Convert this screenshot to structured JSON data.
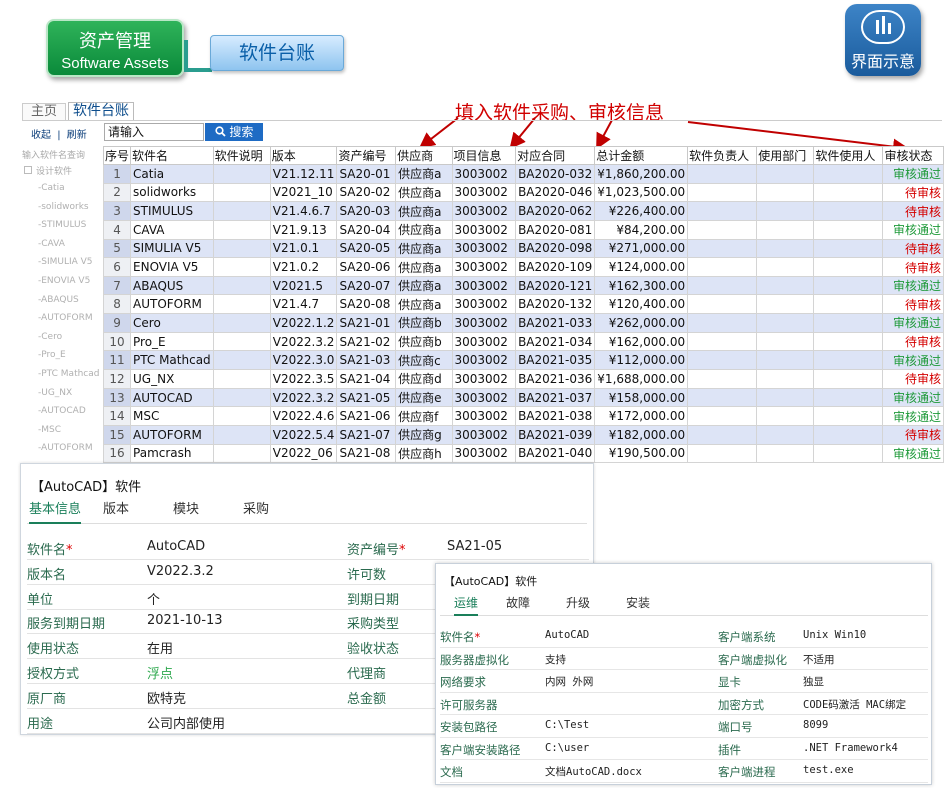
{
  "header": {
    "badge_title": "资产管理",
    "badge_subtitle": "Software Assets",
    "section_label": "软件台账",
    "ui_badge_label": "界面示意"
  },
  "annotation": "填入软件采购、审核信息",
  "tabs": {
    "home": "主页",
    "ledger": "软件台账"
  },
  "toolbar": {
    "collapse": "收起",
    "separator": "|",
    "refresh": "刷新",
    "search_placeholder": "请输入",
    "search_label": "搜索"
  },
  "sidebar": {
    "filter_placeholder": "输入软件名查询",
    "root": "设计软件",
    "items": [
      "-Catia",
      "-solidworks",
      "-STIMULUS",
      "-CAVA",
      "-SIMULIA V5",
      "-ENOVIA V5",
      "-ABAQUS",
      "-AUTOFORM",
      "-Cero",
      "-Pro_E",
      "-PTC Mathcad",
      "-UG_NX",
      "-AUTOCAD",
      "-MSC",
      "-AUTOFORM"
    ]
  },
  "table": {
    "columns": [
      "序号",
      "软件名",
      "软件说明",
      "版本",
      "资产编号",
      "供应商",
      "项目信息",
      "对应合同",
      "总计金额",
      "软件负责人",
      "使用部门",
      "软件使用人",
      "审核状态"
    ],
    "rows": [
      [
        "1",
        "Catia",
        "",
        "V21.12.11",
        "SA20-01",
        "供应商a",
        "3003002",
        "BA2020-032",
        "¥1,860,200.00",
        "",
        "",
        "",
        "审核通过"
      ],
      [
        "2",
        "solidworks",
        "",
        "V2021_10",
        "SA20-02",
        "供应商a",
        "3003002",
        "BA2020-046",
        "¥1,023,500.00",
        "",
        "",
        "",
        "待审核"
      ],
      [
        "3",
        "STIMULUS",
        "",
        "V21.4.6.7",
        "SA20-03",
        "供应商a",
        "3003002",
        "BA2020-062",
        "¥226,400.00",
        "",
        "",
        "",
        "待审核"
      ],
      [
        "4",
        "CAVA",
        "",
        "V21.9.13",
        "SA20-04",
        "供应商a",
        "3003002",
        "BA2020-081",
        "¥84,200.00",
        "",
        "",
        "",
        "审核通过"
      ],
      [
        "5",
        "SIMULIA V5",
        "",
        "V21.0.1",
        "SA20-05",
        "供应商a",
        "3003002",
        "BA2020-098",
        "¥271,000.00",
        "",
        "",
        "",
        "待审核"
      ],
      [
        "6",
        "ENOVIA V5",
        "",
        "V21.0.2",
        "SA20-06",
        "供应商a",
        "3003002",
        "BA2020-109",
        "¥124,000.00",
        "",
        "",
        "",
        "待审核"
      ],
      [
        "7",
        "ABAQUS",
        "",
        "V2021.5",
        "SA20-07",
        "供应商a",
        "3003002",
        "BA2020-121",
        "¥162,300.00",
        "",
        "",
        "",
        "审核通过"
      ],
      [
        "8",
        "AUTOFORM",
        "",
        "V21.4.7",
        "SA20-08",
        "供应商a",
        "3003002",
        "BA2020-132",
        "¥120,400.00",
        "",
        "",
        "",
        "待审核"
      ],
      [
        "9",
        "Cero",
        "",
        "V2022.1.2",
        "SA21-01",
        "供应商b",
        "3003002",
        "BA2021-033",
        "¥262,000.00",
        "",
        "",
        "",
        "审核通过"
      ],
      [
        "10",
        "Pro_E",
        "",
        "V2022.3.2",
        "SA21-02",
        "供应商b",
        "3003002",
        "BA2021-034",
        "¥162,000.00",
        "",
        "",
        "",
        "待审核"
      ],
      [
        "11",
        "PTC Mathcad",
        "",
        "V2022.3.0",
        "SA21-03",
        "供应商c",
        "3003002",
        "BA2021-035",
        "¥112,000.00",
        "",
        "",
        "",
        "审核通过"
      ],
      [
        "12",
        "UG_NX",
        "",
        "V2022.3.5",
        "SA21-04",
        "供应商d",
        "3003002",
        "BA2021-036",
        "¥1,688,000.00",
        "",
        "",
        "",
        "待审核"
      ],
      [
        "13",
        "AUTOCAD",
        "",
        "V2022.3.2",
        "SA21-05",
        "供应商e",
        "3003002",
        "BA2021-037",
        "¥158,000.00",
        "",
        "",
        "",
        "审核通过"
      ],
      [
        "14",
        "MSC",
        "",
        "V2022.4.6",
        "SA21-06",
        "供应商f",
        "3003002",
        "BA2021-038",
        "¥172,000.00",
        "",
        "",
        "",
        "审核通过"
      ],
      [
        "15",
        "AUTOFORM",
        "",
        "V2022.5.4",
        "SA21-07",
        "供应商g",
        "3003002",
        "BA2021-039",
        "¥182,000.00",
        "",
        "",
        "",
        "待审核"
      ],
      [
        "16",
        "Pamcrash",
        "",
        "V2022_06",
        "SA21-08",
        "供应商h",
        "3003002",
        "BA2021-040",
        "¥190,500.00",
        "",
        "",
        "",
        "审核通过"
      ]
    ]
  },
  "detail1": {
    "title": "【AutoCAD】软件",
    "tabs": [
      "基本信息",
      "版本",
      "模块",
      "采购"
    ],
    "fields": [
      {
        "k": "软件名",
        "req": "*",
        "v": "AutoCAD",
        "k2": "资产编号",
        "req2": "*",
        "v2": "SA21-05"
      },
      {
        "k": "版本名",
        "req": "",
        "v": "V2022.3.2",
        "k2": "许可数",
        "req2": "",
        "v2": ""
      },
      {
        "k": "单位",
        "req": "",
        "v": "个",
        "k2": "到期日期",
        "req2": "",
        "v2": ""
      },
      {
        "k": "服务到期日期",
        "req": "",
        "v": "2021-10-13",
        "k2": "采购类型",
        "req2": "",
        "v2": ""
      },
      {
        "k": "使用状态",
        "req": "",
        "v": "在用",
        "k2": "验收状态",
        "req2": "",
        "v2": ""
      },
      {
        "k": "授权方式",
        "req": "",
        "v": "浮点",
        "k2": "代理商",
        "req2": "",
        "v2": ""
      },
      {
        "k": "原厂商",
        "req": "",
        "v": "欧特克",
        "k2": "总金额",
        "req2": "",
        "v2": ""
      },
      {
        "k": "用途",
        "req": "",
        "v": "公司内部使用",
        "k2": "",
        "req2": "",
        "v2": ""
      }
    ]
  },
  "detail2": {
    "title": "【AutoCAD】软件",
    "tabs": [
      "运维",
      "故障",
      "升级",
      "安装"
    ],
    "fields": [
      {
        "k": "软件名",
        "req": "*",
        "v": "AutoCAD",
        "k2": "客户端系统",
        "v2": "Unix Win10"
      },
      {
        "k": "服务器虚拟化",
        "req": "",
        "v": "支持",
        "k2": "客户端虚拟化",
        "v2": "不适用"
      },
      {
        "k": "网络要求",
        "req": "",
        "v": "内网 外网",
        "k2": "显卡",
        "v2": "独显"
      },
      {
        "k": "许可服务器",
        "req": "",
        "v": "",
        "k2": "加密方式",
        "v2": "CODE码激活 MAC绑定"
      },
      {
        "k": "安装包路径",
        "req": "",
        "v": "C:\\Test",
        "k2": "端口号",
        "v2": "8099"
      },
      {
        "k": "客户端安装路径",
        "req": "",
        "v": "C:\\user",
        "k2": "插件",
        "v2": ".NET Framework4"
      },
      {
        "k": "文档",
        "req": "",
        "v": "文档AutoCAD.docx",
        "k2": "客户端进程",
        "v2": "test.exe"
      }
    ]
  },
  "colors": {
    "pass": "#1f9a3a",
    "pending": "#d40000",
    "row_alt": "#dde4f6",
    "accent": "#1e6bc4",
    "annotation": "#d00000"
  }
}
